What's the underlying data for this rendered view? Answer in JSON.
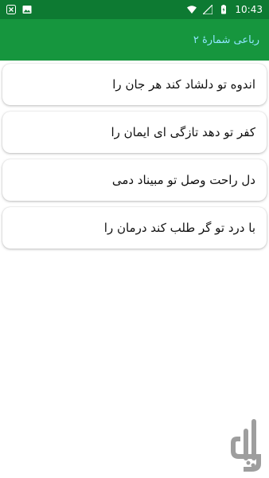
{
  "status_bar": {
    "time": "10:43"
  },
  "app_bar": {
    "title": "رباعی شمارهٔ ۲"
  },
  "verses": [
    {
      "text": "اندوه تو دلشاد کند هر جان را"
    },
    {
      "text": "کفر تو دهد تازگی ای ایمان را"
    },
    {
      "text": "دل راحت وصل تو مبیناد دمی"
    },
    {
      "text": "با درد تو گر طلب کند درمان را"
    }
  ],
  "colors": {
    "status_bar": "#0d7a32",
    "app_bar": "#16963e",
    "title": "#8fe6ff"
  }
}
